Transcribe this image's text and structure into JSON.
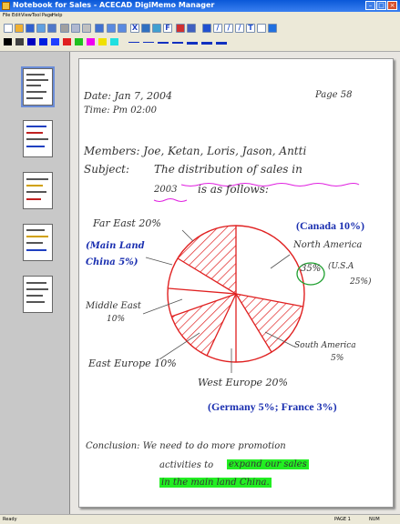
{
  "window": {
    "title": "Notebook for Sales - ACECAD DigiMemo Manager"
  },
  "menu": [
    "File",
    "Edit",
    "View",
    "Tool",
    "Page",
    "Help"
  ],
  "toolbar": {
    "tools": [
      "new-file",
      "open-folder",
      "save",
      "export",
      "print",
      "cut",
      "copy",
      "paste",
      "undo",
      "zoom-in",
      "zoom-out",
      "delete",
      "image",
      "font",
      "insert",
      "grid",
      "pen",
      "pencil",
      "line",
      "line-2",
      "text",
      "rectangle",
      "highlighter"
    ],
    "text_tool_label": "T",
    "font_tool_label": "F",
    "delete_tool_label": "X",
    "colors": [
      "#000000",
      "#404040",
      "#0000c0",
      "#0020e0",
      "#2040ff",
      "#e02020",
      "#20c020",
      "#f000f0",
      "#f0e000",
      "#20e0e0"
    ]
  },
  "page": {
    "date_line": "Date: Jan 7, 2004",
    "page_no": "Page 58",
    "time_line": "Time: Pm 02:00",
    "members_line": "Members: Joe, Ketan, Loris, Jason, Antti",
    "subject_prefix": "Subject:",
    "subject_underlined_1": "The distribution of sales in",
    "subject_year": "2003",
    "subject_rest": "is as follows:",
    "label_far_east": "Far East 20%",
    "label_main_land": "(Main Land",
    "label_china": "China 5%)",
    "label_middle_east": "Middle East",
    "label_middle_east_pct": "10%",
    "label_east_europe": "East Europe 10%",
    "label_west_europe": "West Europe 20%",
    "label_north_america": "North America",
    "label_north_america_pct": "35%",
    "label_usa": "(U.S.A",
    "label_usa_pct": "25%)",
    "label_south_america": "South America",
    "label_south_america_pct": "5%",
    "typed_canada": "(Canada 10%)",
    "typed_germany": "(Germany 5%; France 3%)",
    "conclusion_1": "Conclusion: We need to do more promotion",
    "conclusion_2a": "activities to",
    "conclusion_2b": "expand our sales",
    "conclusion_3": "in the main land China."
  },
  "status": {
    "left": "Ready",
    "page": "PAGE 1",
    "mode": "NUM"
  }
}
